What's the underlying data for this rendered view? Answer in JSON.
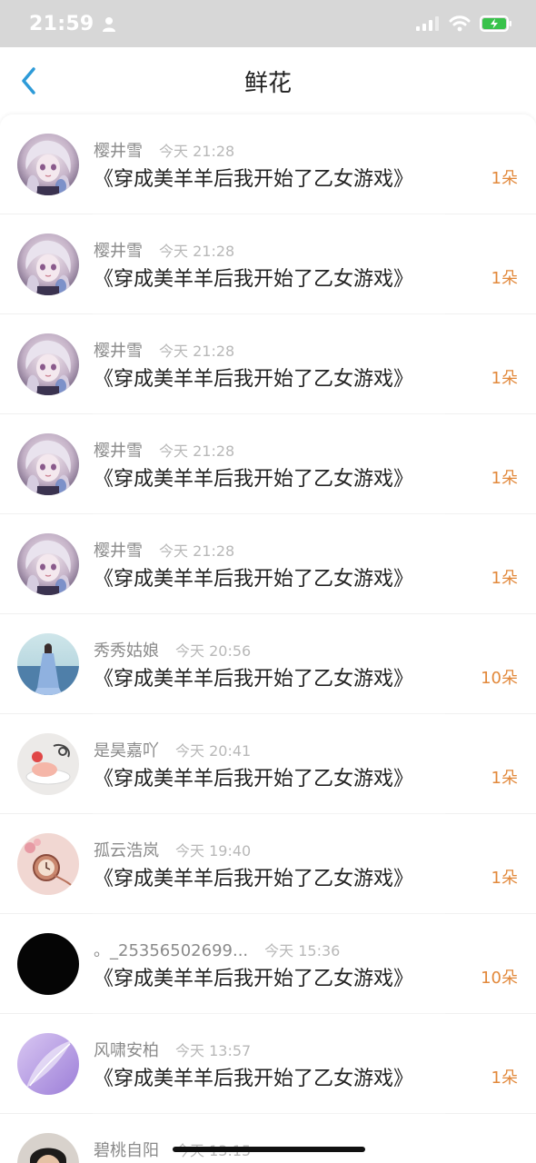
{
  "status_bar": {
    "time": "21:59"
  },
  "header": {
    "title": "鲜花"
  },
  "items": [
    {
      "user": "樱井雪",
      "time": "今天 21:28",
      "title": "《穿成美羊羊后我开始了乙女游戏》",
      "count": "1朵",
      "avatar": "anime-girl"
    },
    {
      "user": "樱井雪",
      "time": "今天 21:28",
      "title": "《穿成美羊羊后我开始了乙女游戏》",
      "count": "1朵",
      "avatar": "anime-girl"
    },
    {
      "user": "樱井雪",
      "time": "今天 21:28",
      "title": "《穿成美羊羊后我开始了乙女游戏》",
      "count": "1朵",
      "avatar": "anime-girl"
    },
    {
      "user": "樱井雪",
      "time": "今天 21:28",
      "title": "《穿成美羊羊后我开始了乙女游戏》",
      "count": "1朵",
      "avatar": "anime-girl"
    },
    {
      "user": "樱井雪",
      "time": "今天 21:28",
      "title": "《穿成美羊羊后我开始了乙女游戏》",
      "count": "1朵",
      "avatar": "anime-girl"
    },
    {
      "user": "秀秀姑娘",
      "time": "今天 20:56",
      "title": "《穿成美羊羊后我开始了乙女游戏》",
      "count": "10朵",
      "avatar": "blue-dress-girl"
    },
    {
      "user": "是昊嘉吖",
      "time": "今天 20:41",
      "title": "《穿成美羊羊后我开始了乙女游戏》",
      "count": "1朵",
      "avatar": "dessert"
    },
    {
      "user": "孤云浩岚",
      "time": "今天 19:40",
      "title": "《穿成美羊羊后我开始了乙女游戏》",
      "count": "1朵",
      "avatar": "pink-watch"
    },
    {
      "user": "。_25356502699...",
      "time": "今天 15:36",
      "title": "《穿成美羊羊后我开始了乙女游戏》",
      "count": "10朵",
      "avatar": "black"
    },
    {
      "user": "风啸安柏",
      "time": "今天 13:57",
      "title": "《穿成美羊羊后我开始了乙女游戏》",
      "count": "1朵",
      "avatar": "purple-feather"
    },
    {
      "user": "碧桃自阳",
      "time": "今天 13:15",
      "title": "",
      "count": "",
      "avatar": "photo-person"
    }
  ]
}
